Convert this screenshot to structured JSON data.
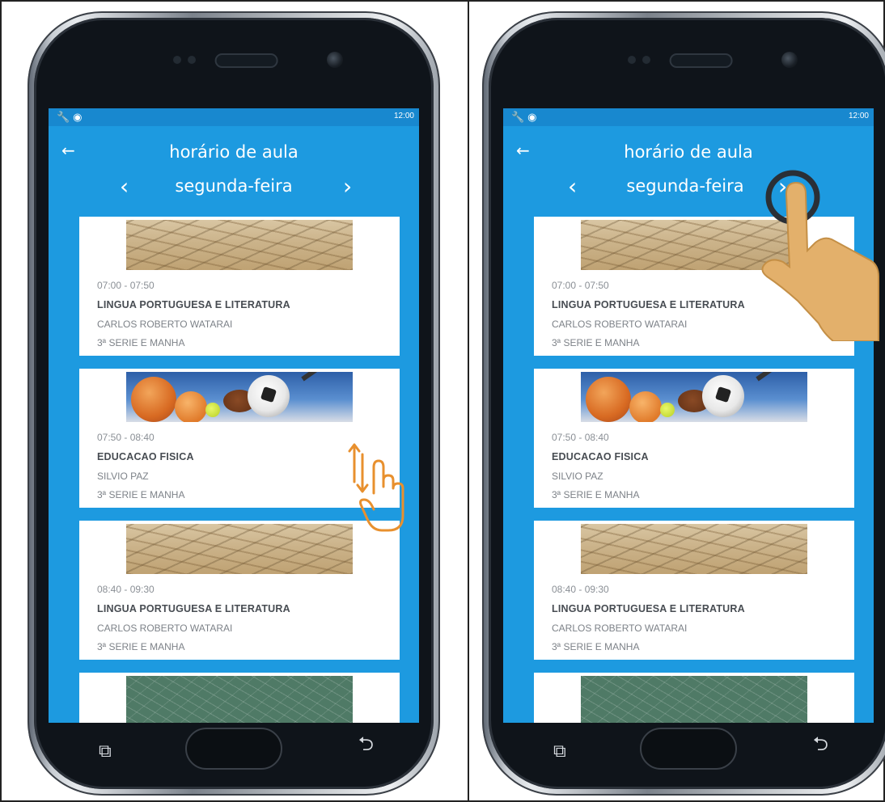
{
  "phones": [
    {
      "status_time": "12:00",
      "app_title": "horário de aula",
      "day_label": "segunda-feira",
      "back_glyph": "←",
      "prev_glyph": "‹",
      "next_glyph": "›",
      "gesture": "swipe-vertical",
      "cards": [
        {
          "time": "07:00 - 07:50",
          "subject": "LINGUA PORTUGUESA E LITERATURA",
          "teacher": "CARLOS ROBERTO WATARAI",
          "grade": "3ª SERIE E MANHA",
          "image": "sand"
        },
        {
          "time": "07:50 - 08:40",
          "subject": "EDUCACAO FISICA",
          "teacher": "SILVIO PAZ",
          "grade": "3ª SERIE E MANHA",
          "image": "sports"
        },
        {
          "time": "08:40 - 09:30",
          "subject": "LINGUA PORTUGUESA E LITERATURA",
          "teacher": "CARLOS ROBERTO WATARAI",
          "grade": "3ª SERIE E MANHA",
          "image": "sand"
        }
      ]
    },
    {
      "status_time": "12:00",
      "app_title": "horário de aula",
      "day_label": "segunda-feira",
      "back_glyph": "←",
      "prev_glyph": "‹",
      "next_glyph": "›",
      "gesture": "tap-next",
      "cards": [
        {
          "time": "07:00 - 07:50",
          "subject": "LINGUA PORTUGUESA E LITERATURA",
          "teacher": "CARLOS ROBERTO WATARAI",
          "grade": "3ª SERIE E MANHA",
          "image": "sand"
        },
        {
          "time": "07:50 - 08:40",
          "subject": "EDUCACAO FISICA",
          "teacher": "SILVIO PAZ",
          "grade": "3ª SERIE E MANHA",
          "image": "sports"
        },
        {
          "time": "08:40 - 09:30",
          "subject": "LINGUA PORTUGUESA E LITERATURA",
          "teacher": "CARLOS ROBERTO WATARAI",
          "grade": "3ª SERIE E MANHA",
          "image": "sand"
        }
      ]
    }
  ],
  "colors": {
    "app_blue": "#1d9ae0",
    "gesture_orange": "#e8902e",
    "hand_skin": "#e3b06b"
  }
}
